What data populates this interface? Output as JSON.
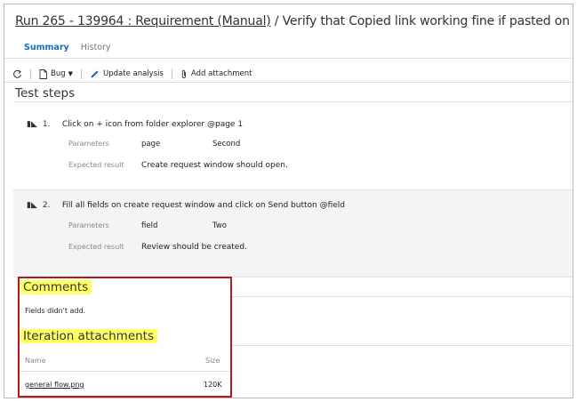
{
  "header": {
    "run_label": "Run 265 - 139964",
    "separator": " : ",
    "requirement_label": "Requirement (Manual)",
    "slash": " / ",
    "test_title": "Verify that Copied link working fine if pasted on different browsers."
  },
  "tabs": [
    {
      "label": "Summary",
      "active": true
    },
    {
      "label": "History",
      "active": false
    }
  ],
  "toolbar": {
    "refresh_icon": "refresh-icon",
    "bug_label": "Bug",
    "update_label": "Update analysis",
    "attach_label": "Add attachment"
  },
  "test_steps": {
    "title": "Test steps",
    "steps": [
      {
        "number": "1.",
        "text": "Click on + icon from folder explorer @page 1",
        "parameters_label": "Parameters",
        "param_name": "page",
        "param_value": "Second",
        "expected_label": "Expected result",
        "expected": "Create request window should open."
      },
      {
        "number": "2.",
        "text": "Fill all fields on create request window and click on Send button @field",
        "parameters_label": "Parameters",
        "param_name": "field",
        "param_value": "Two",
        "expected_label": "Expected result",
        "expected": "Review should be created."
      }
    ]
  },
  "comments": {
    "title": "Comments",
    "text": "Fields didn't add."
  },
  "attachments": {
    "title": "Iteration attachments",
    "col_name": "Name",
    "col_size": "Size",
    "rows": [
      {
        "name": "general flow.png",
        "size": "120K"
      }
    ]
  },
  "colors": {
    "accent": "#106ebe",
    "highlight": "#ffff66",
    "callout_border": "#b31b1b",
    "alt_row_bg": "#f4f4f4"
  }
}
